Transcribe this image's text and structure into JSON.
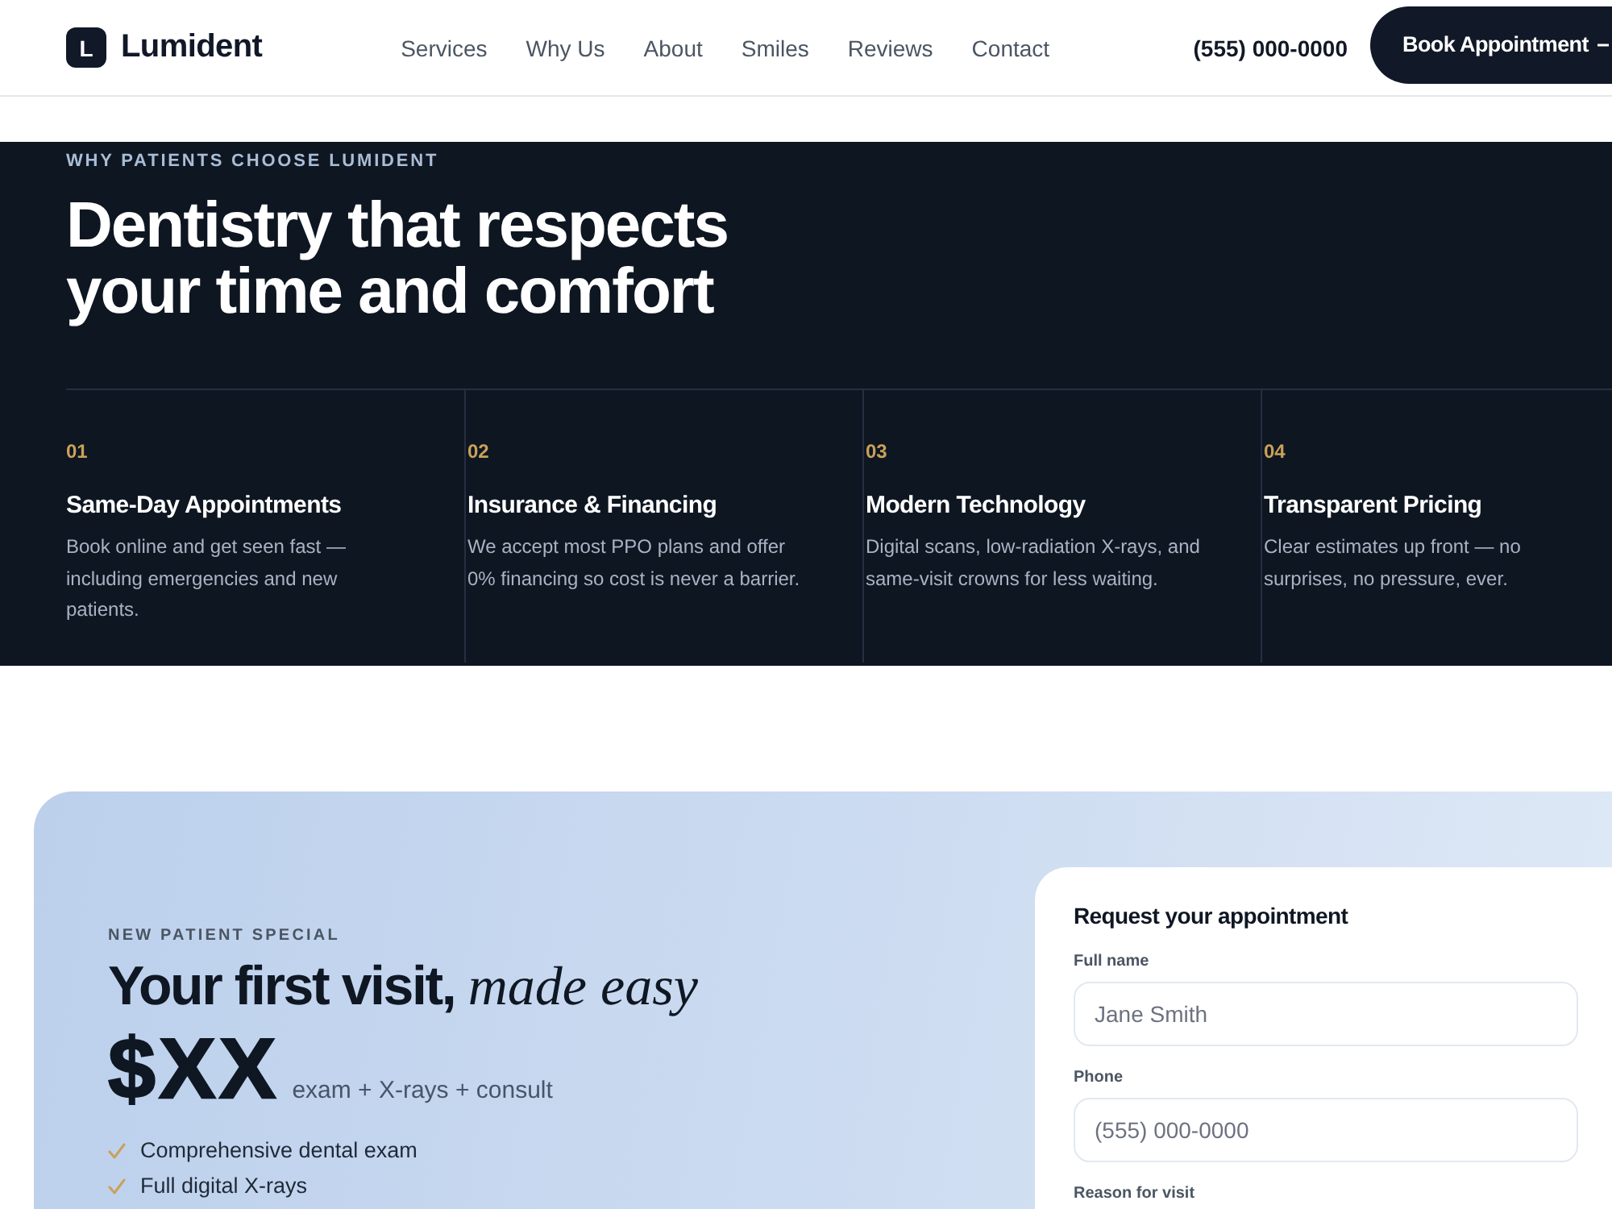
{
  "header": {
    "logo": {
      "mark": "L",
      "name": "Lumident"
    },
    "nav": [
      "Services",
      "Why Us",
      "About",
      "Smiles",
      "Reviews",
      "Contact"
    ],
    "phone": "(555) 000-0000",
    "cta": "Book Appointment"
  },
  "features": {
    "eyebrow": "WHY PATIENTS CHOOSE LUMIDENT",
    "heading": "Dentistry that respects your time and comfort",
    "items": [
      {
        "number": "01",
        "title": "Same-Day Appointments",
        "text": "Book online and get seen fast — including emergencies and new patients."
      },
      {
        "number": "02",
        "title": "Insurance & Financing",
        "text": "We accept most PPO plans and offer 0% financing so cost is never a barrier."
      },
      {
        "number": "03",
        "title": "Modern Technology",
        "text": "Digital scans, low-radiation X-rays, and same-visit crowns for less waiting."
      },
      {
        "number": "04",
        "title": "Transparent Pricing",
        "text": "Clear estimates up front — no surprises, no pressure, ever."
      }
    ]
  },
  "offer": {
    "eyebrow": "NEW PATIENT SPECIAL",
    "heading": "Your first visit, *made easy*",
    "price": "$XX",
    "price_note": "exam + X-rays + consult",
    "checklist": [
      "Comprehensive dental exam",
      "Full digital X-rays"
    ]
  },
  "form": {
    "title": "Request your appointment",
    "fields": [
      {
        "label": "Full name",
        "placeholder": "Jane Smith"
      },
      {
        "label": "Phone",
        "placeholder": "(555) 000-0000"
      },
      {
        "label": "Reason for visit"
      }
    ]
  }
}
